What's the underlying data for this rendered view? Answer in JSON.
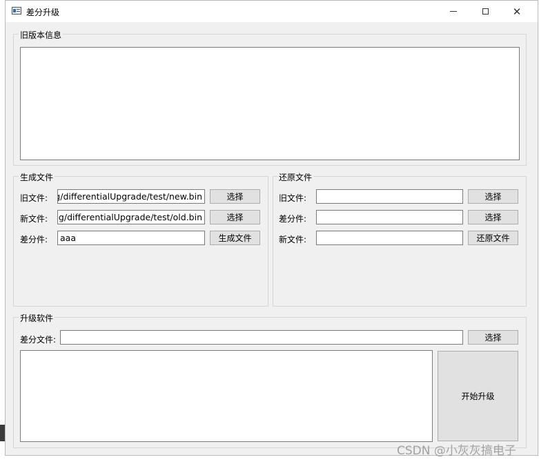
{
  "window": {
    "title": "差分升级"
  },
  "old_version": {
    "title": "旧版本信息",
    "content": ""
  },
  "generate": {
    "title": "生成文件",
    "old_file_label": "旧文件:",
    "old_file_value": "ng/differentialUpgrade/test/new.bin",
    "new_file_label": "新文件:",
    "new_file_value": "ing/differentialUpgrade/test/old.bin",
    "diff_file_label": "差分件:",
    "diff_file_value": "aaa",
    "choose_label": "选择",
    "generate_label": "生成文件"
  },
  "restore": {
    "title": "还原文件",
    "old_file_label": "旧文件:",
    "diff_file_label": "差分件:",
    "new_file_label": "新文件:",
    "old_file_value": "",
    "diff_file_value": "",
    "new_file_value": "",
    "choose_label": "选择",
    "restore_label": "还原文件"
  },
  "upgrade": {
    "title": "升级软件",
    "diff_file_label": "差分文件:",
    "diff_file_value": "",
    "choose_label": "选择",
    "log": "",
    "start_label": "开始升级"
  },
  "watermark": "CSDN @小灰灰搞电子"
}
